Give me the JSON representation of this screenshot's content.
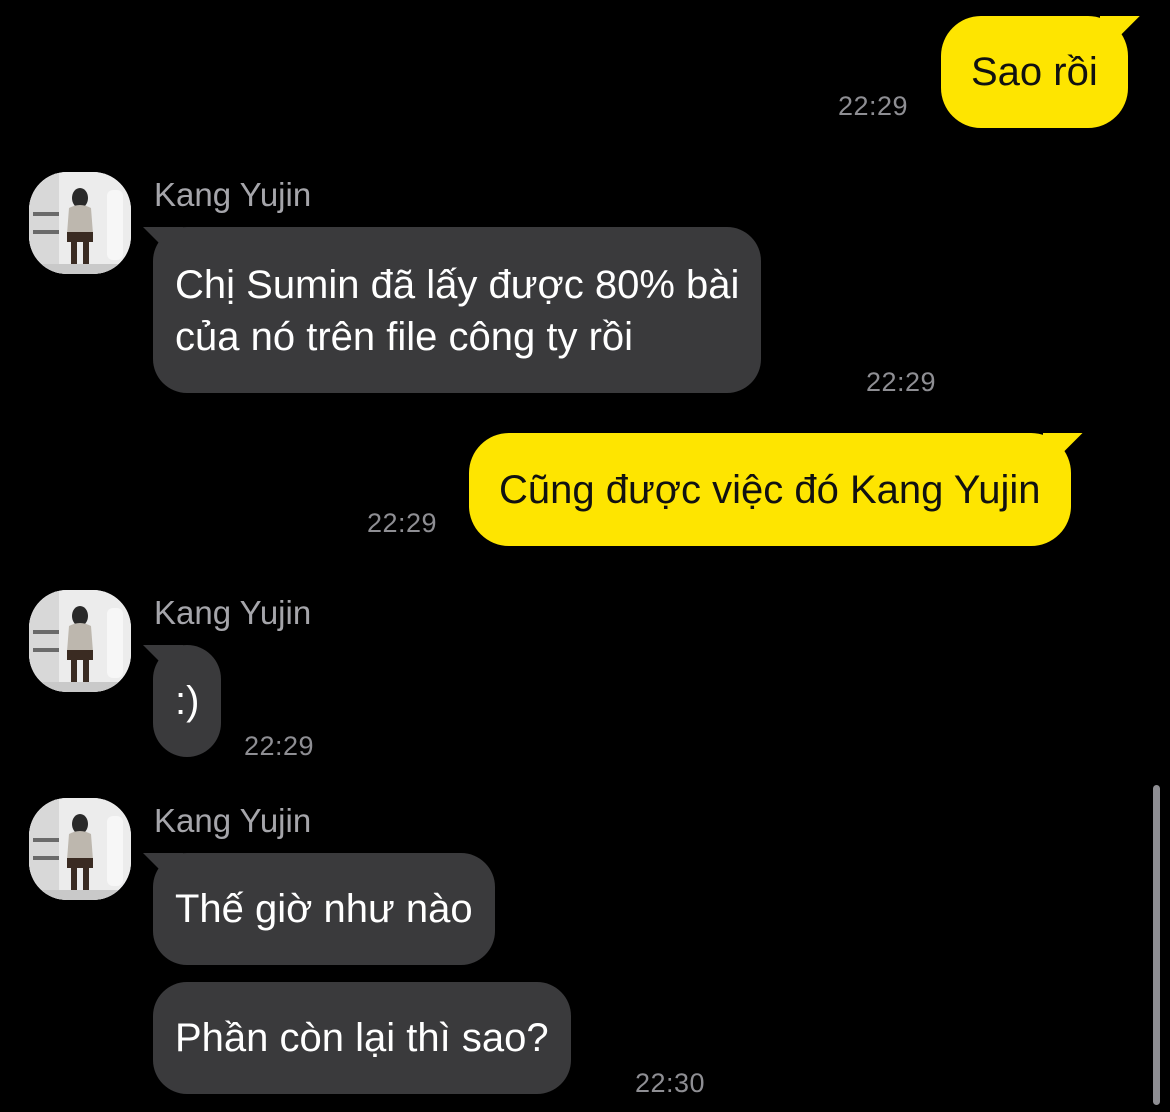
{
  "contact": {
    "name": "Kang Yujin"
  },
  "messages": [
    {
      "direction": "outgoing",
      "text": "Sao rồi",
      "time": "22:29"
    },
    {
      "direction": "incoming",
      "sender": "Kang Yujin",
      "text_line_1": "Chị Sumin đã lấy được 80% bài",
      "text_line_2": "của nó trên file công ty rồi",
      "time": "22:29"
    },
    {
      "direction": "outgoing",
      "text": "Cũng được việc đó Kang Yujin",
      "time": "22:29"
    },
    {
      "direction": "incoming",
      "sender": "Kang Yujin",
      "text": ":)",
      "time": "22:29"
    },
    {
      "direction": "incoming",
      "sender": "Kang Yujin",
      "text": "Thế giờ như nào"
    },
    {
      "direction": "incoming",
      "text": "Phần còn lại thì sao?",
      "time": "22:30"
    }
  ],
  "icons": {
    "avatar": "avatar-photo-icon"
  },
  "colors": {
    "background": "#000000",
    "outgoing_bubble": "#fee500",
    "incoming_bubble": "#3a3a3c",
    "timestamp": "#8e8e93"
  }
}
